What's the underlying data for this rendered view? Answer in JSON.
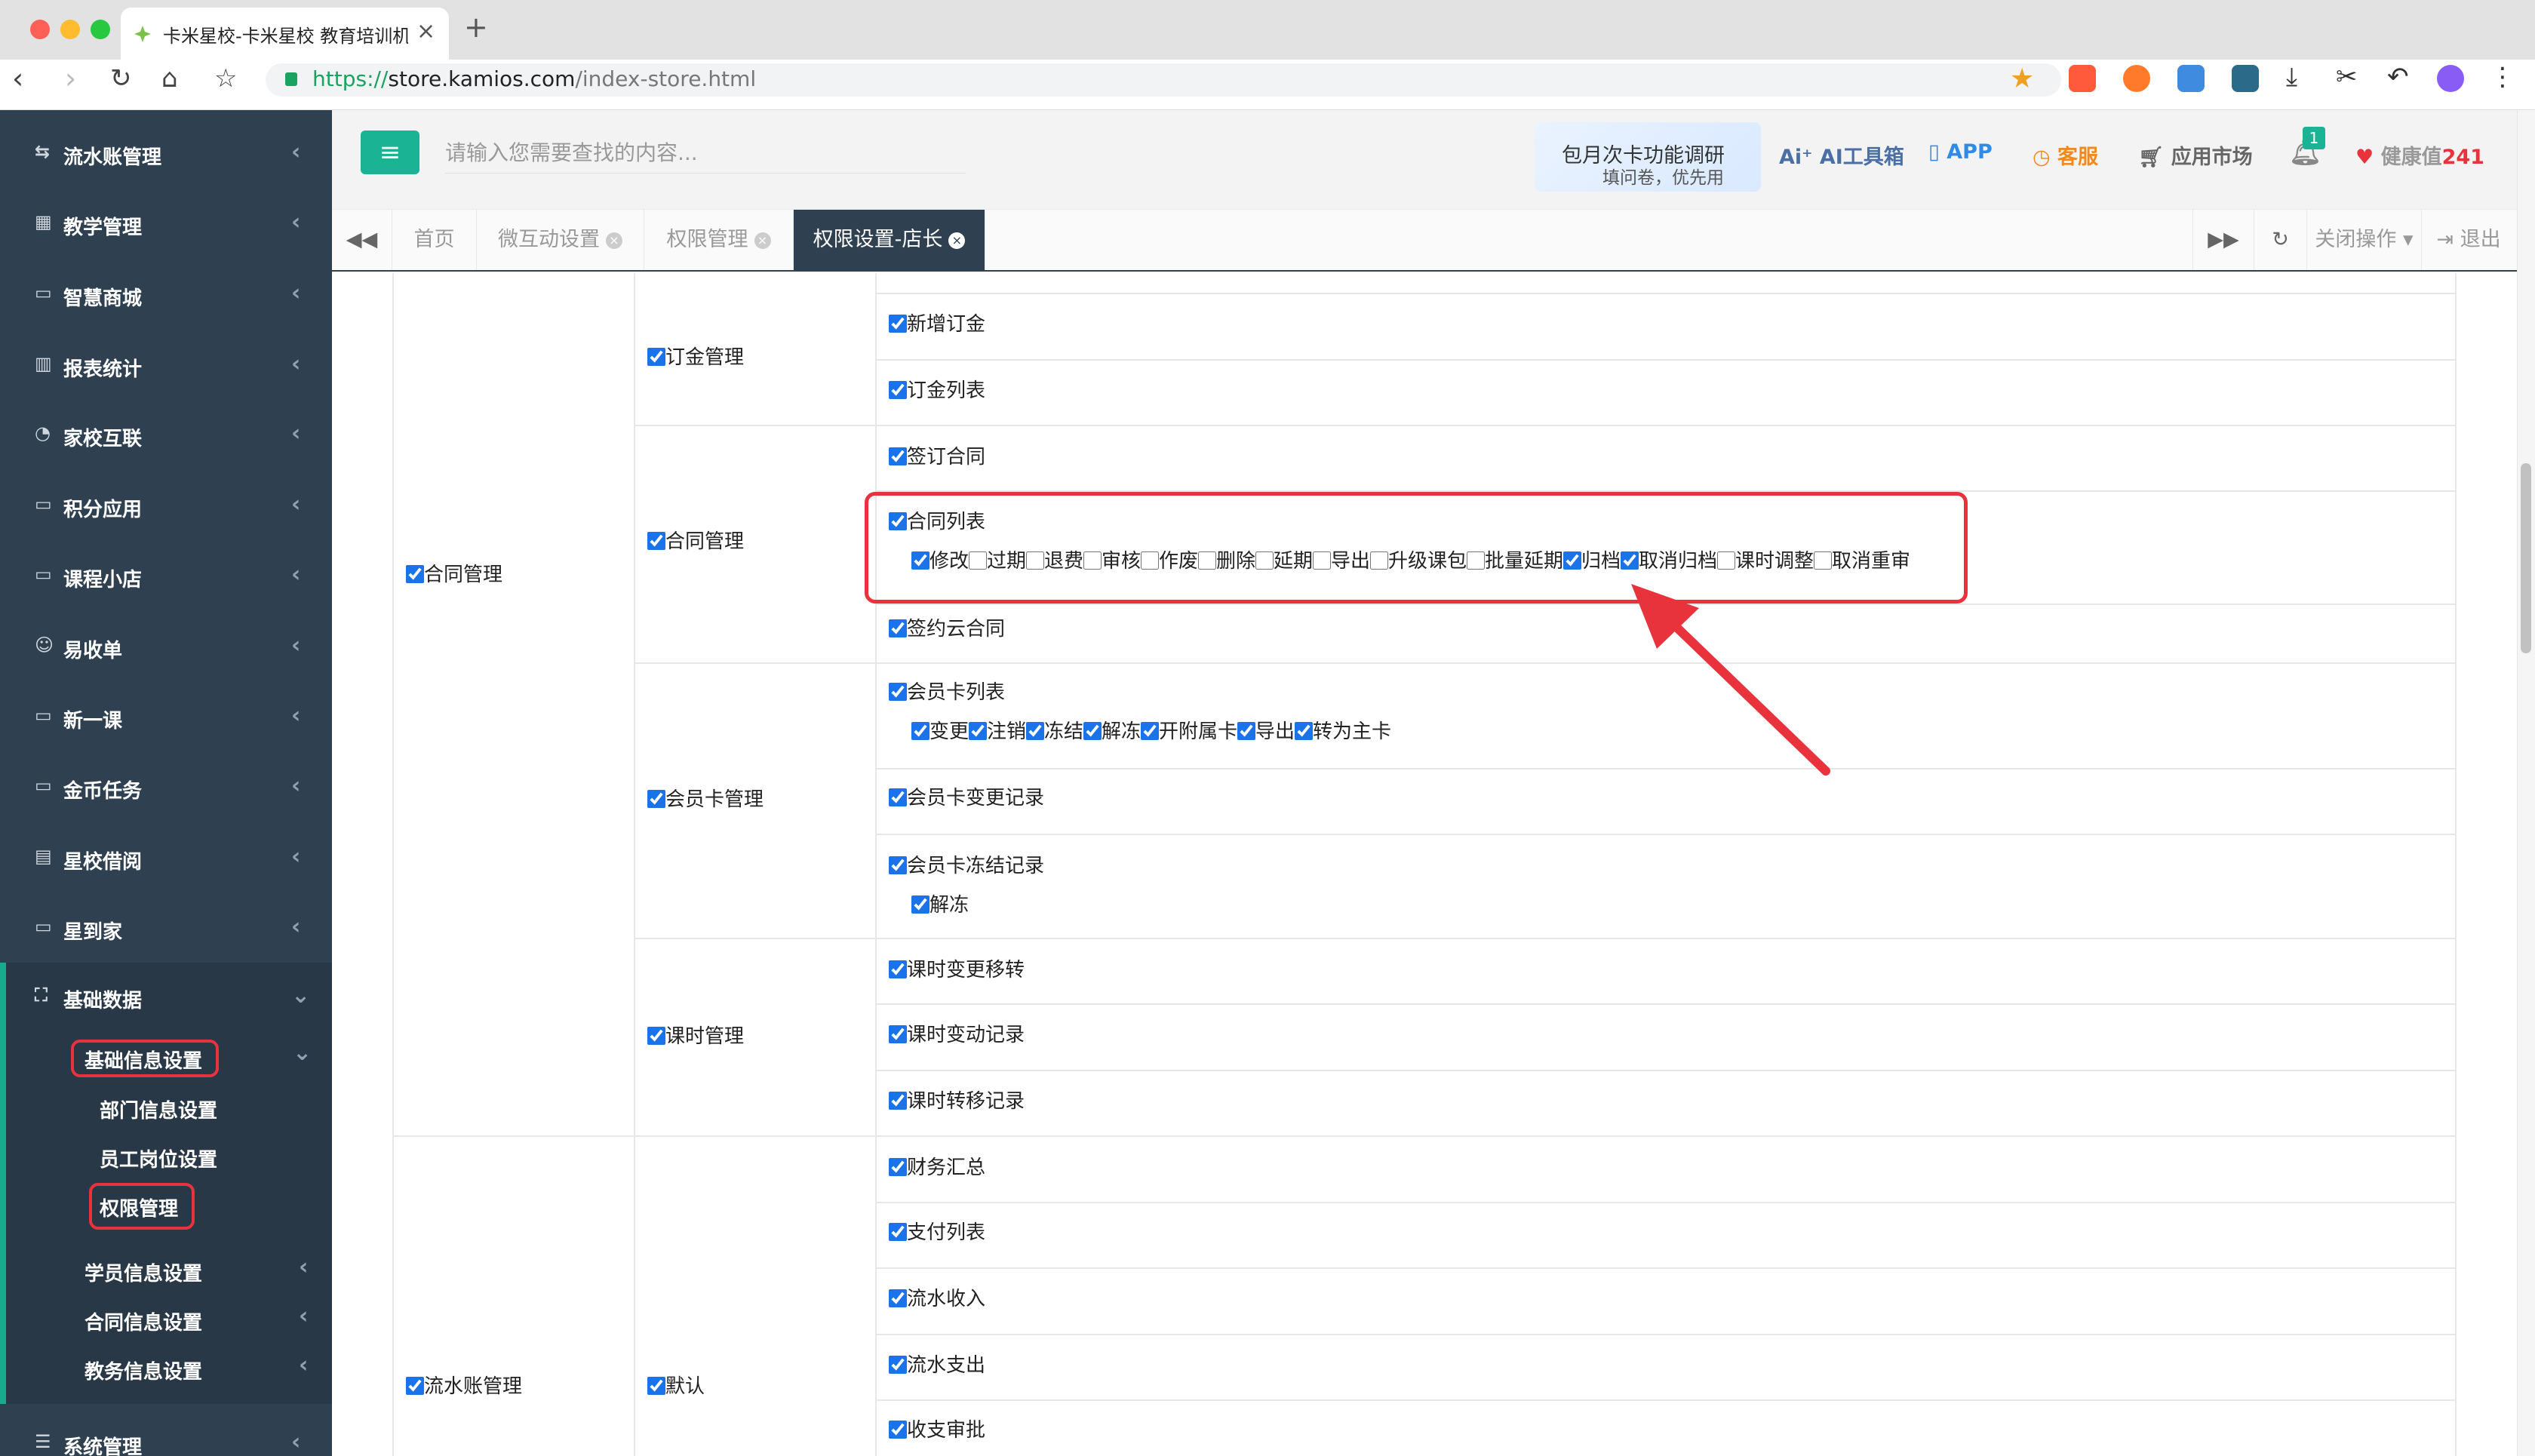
{
  "browser": {
    "tab_title": "卡米星校-卡米星校 教育培训机构管理系统",
    "url_scheme": "https://",
    "url_host": "store.kamios.com",
    "url_path": "/index-store.html"
  },
  "sidebar": {
    "items": [
      {
        "icon": "flow-icon",
        "label": "流水账管理"
      },
      {
        "icon": "calendar-icon",
        "label": "教学管理"
      },
      {
        "icon": "laptop-icon",
        "label": "智慧商城"
      },
      {
        "icon": "bar-chart-icon",
        "label": "报表统计"
      },
      {
        "icon": "chat-icon",
        "label": "家校互联"
      },
      {
        "icon": "laptop-icon",
        "label": "积分应用"
      },
      {
        "icon": "laptop-icon",
        "label": "课程小店"
      },
      {
        "icon": "user-plus-icon",
        "label": "易收单"
      },
      {
        "icon": "laptop-icon",
        "label": "新一课"
      },
      {
        "icon": "laptop-icon",
        "label": "金币任务"
      },
      {
        "icon": "book-icon",
        "label": "星校借阅"
      },
      {
        "icon": "laptop-icon",
        "label": "星到家"
      }
    ],
    "expanded": {
      "label": "基础数据",
      "sub_active": "基础信息设置",
      "sub_children": [
        "部门信息设置",
        "员工岗位设置",
        "权限管理"
      ],
      "others": [
        "学员信息设置",
        "合同信息设置",
        "教务信息设置"
      ]
    },
    "bottom": "系统管理"
  },
  "header": {
    "search_placeholder": "请输入您需要查找的内容...",
    "promo_title": "包月次卡功能调研",
    "promo_sub": "填问卷，优先用",
    "ai_tools": "AI工具箱",
    "app": "APP",
    "service": "客服",
    "market": "应用市场",
    "notif_count": "1",
    "health": "健康值",
    "health_value": "241"
  },
  "tabs": {
    "items": [
      "首页",
      "微互动设置",
      "权限管理",
      "权限设置-店长"
    ],
    "close_ops": "关闭操作",
    "logout": "退出"
  },
  "permissions": {
    "group1": {
      "label": "合同管理",
      "checked": true
    },
    "group2": {
      "label": "流水账管理",
      "checked": true
    },
    "modules": {
      "deposit": "订金管理",
      "contract": "合同管理",
      "card": "会员卡管理",
      "hours": "课时管理",
      "default": "默认"
    },
    "items": {
      "new_deposit": "新增订金",
      "deposit_list": "订金列表",
      "sign_contract": "签订合同",
      "contract_list": "合同列表",
      "sign_cloud": "签约云合同",
      "card_list": "会员卡列表",
      "card_change": "会员卡变更记录",
      "card_freeze": "会员卡冻结记录",
      "unfreeze": "解冻",
      "hour_transfer": "课时变更移转",
      "hour_change": "课时变动记录",
      "hour_move": "课时转移记录",
      "finance": "财务汇总",
      "pay_list": "支付列表",
      "income": "流水收入",
      "expense": "流水支出",
      "approve": "收支审批"
    },
    "contract_actions": [
      {
        "label": "修改",
        "checked": true
      },
      {
        "label": "过期",
        "checked": false
      },
      {
        "label": "退费",
        "checked": false
      },
      {
        "label": "审核",
        "checked": false
      },
      {
        "label": "作废",
        "checked": false
      },
      {
        "label": "删除",
        "checked": false
      },
      {
        "label": "延期",
        "checked": false
      },
      {
        "label": "导出",
        "checked": false
      },
      {
        "label": "升级课包",
        "checked": false
      },
      {
        "label": "批量延期",
        "checked": false
      },
      {
        "label": "归档",
        "checked": true
      },
      {
        "label": "取消归档",
        "checked": true
      },
      {
        "label": "课时调整",
        "checked": false
      },
      {
        "label": "取消重审",
        "checked": false
      }
    ],
    "card_actions": [
      {
        "label": "变更",
        "checked": true
      },
      {
        "label": "注销",
        "checked": true
      },
      {
        "label": "冻结",
        "checked": true
      },
      {
        "label": "解冻",
        "checked": true
      },
      {
        "label": "开附属卡",
        "checked": true
      },
      {
        "label": "导出",
        "checked": true
      },
      {
        "label": "转为主卡",
        "checked": true
      }
    ]
  },
  "colors": {
    "sidebar_bg": "#2f4050",
    "accent": "#1ab394",
    "highlight": "#e8333c"
  }
}
